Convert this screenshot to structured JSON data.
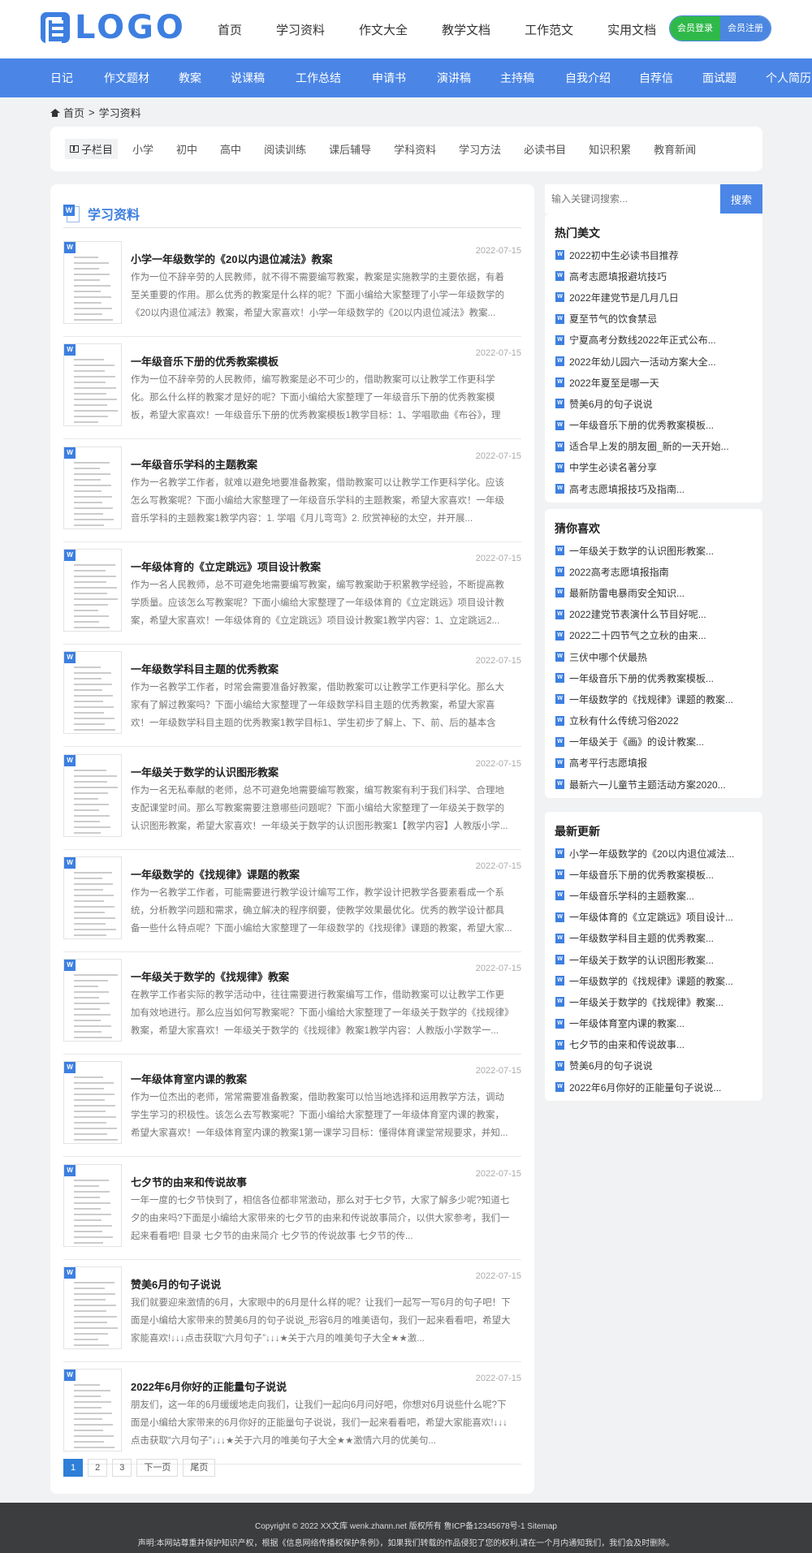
{
  "logo": {
    "text": "LOGO"
  },
  "top_nav": [
    "首页",
    "学习资料",
    "作文大全",
    "教学文档",
    "工作范文",
    "实用文档"
  ],
  "auth": {
    "login_label": "会员登录",
    "register_label": "会员注册"
  },
  "category_nav": [
    "日记",
    "作文题材",
    "教案",
    "说课稿",
    "工作总结",
    "申请书",
    "演讲稿",
    "主持稿",
    "自我介绍",
    "自荐信",
    "面试题",
    "个人简历"
  ],
  "breadcrumb": {
    "home": "首页",
    "sep": ">",
    "current": "学习资料"
  },
  "subnav": {
    "label": "子栏目",
    "items": [
      "小学",
      "初中",
      "高中",
      "阅读训练",
      "课后辅导",
      "学科资料",
      "学习方法",
      "必读书目",
      "知识积累",
      "教育新闻"
    ]
  },
  "main": {
    "title": "学习资料",
    "articles": [
      {
        "title": "小学一年级数学的《20以内退位减法》教案",
        "date": "2022-07-15",
        "desc": "作为一位不辞辛劳的人民教师，就不得不需要编写教案，教案是实施教学的主要依据，有着至关重要的作用。那么优秀的教案是什么样的呢？下面小编给大家整理了小学一年级数学的《20以内退位减法》教案，希望大家喜欢！小学一年级数学的《20以内退位减法》教案..."
      },
      {
        "title": "一年级音乐下册的优秀教案模板",
        "date": "2022-07-15",
        "desc": "作为一位不辞辛劳的人民教师，编写教案是必不可少的，借助教案可以让教学工作更科学化。那么什么样的教案才是好的呢？下面小编给大家整理了一年级音乐下册的优秀教案模板，希望大家喜欢！一年级音乐下册的优秀教案模板1教学目标：1、学唱歌曲《布谷》，理解..."
      },
      {
        "title": "一年级音乐学科的主题教案",
        "date": "2022-07-15",
        "desc": "作为一名教学工作者，就难以避免地要准备教案，借助教案可以让教学工作更科学化。应该怎么写教案呢？下面小编给大家整理了一年级音乐学科的主题教案，希望大家喜欢！一年级音乐学科的主题教案1教学内容：1. 学唱《月儿弯弯》2. 欣赏神秘的太空，并开展..."
      },
      {
        "title": "一年级体育的《立定跳远》项目设计教案",
        "date": "2022-07-15",
        "desc": "作为一名人民教师，总不可避免地需要编写教案，编写教案助于积累教学经验，不断提高教学质量。应该怎么写教案呢？下面小编给大家整理了一年级体育的《立定跳远》项目设计教案，希望大家喜欢！一年级体育的《立定跳远》项目设计教案1教学内容：1、立定跳远2..."
      },
      {
        "title": "一年级数学科目主题的优秀教案",
        "date": "2022-07-15",
        "desc": "作为一名教学工作者，时常会需要准备好教案，借助教案可以让教学工作更科学化。那么大家有了解过教案吗？下面小编给大家整理了一年级数学科目主题的优秀教案，希望大家喜欢！一年级数学科目主题的优秀教案1教学目标1、学生初步了解上、下、前、后的基本含义..."
      },
      {
        "title": "一年级关于数学的认识图形教案",
        "date": "2022-07-15",
        "desc": "作为一名无私奉献的老师，总不可避免地需要编写教案，编写教案有利于我们科学、合理地支配课堂时间。那么写教案需要注意哪些问题呢？下面小编给大家整理了一年级关于数学的认识图形教案，希望大家喜欢！一年级关于数学的认识图形教案1【教学内容】人教版小学..."
      },
      {
        "title": "一年级数学的《找规律》课题的教案",
        "date": "2022-07-15",
        "desc": "作为一名教学工作者，可能需要进行教学设计编写工作，教学设计把教学各要素看成一个系统，分析教学问题和需求，确立解决的程序纲要，使教学效果最优化。优秀的教学设计都具备一些什么特点呢？下面小编给大家整理了一年级数学的《找规律》课题的教案，希望大家..."
      },
      {
        "title": "一年级关于数学的《找规律》教案",
        "date": "2022-07-15",
        "desc": "在教学工作者实际的教学活动中，往往需要进行教案编写工作，借助教案可以让教学工作更加有效地进行。那么应当如何写教案呢？下面小编给大家整理了一年级关于数学的《找规律》教案，希望大家喜欢！一年级关于数学的《找规律》教案1教学内容：人教版小学数学一..."
      },
      {
        "title": "一年级体育室内课的教案",
        "date": "2022-07-15",
        "desc": "作为一位杰出的老师，常常需要准备教案，借助教案可以恰当地选择和运用教学方法，调动学生学习的积极性。该怎么去写教案呢？下面小编给大家整理了一年级体育室内课的教案，希望大家喜欢！一年级体育室内课的教案1第一课学习目标：懂得体育课堂常规要求，并知..."
      },
      {
        "title": "七夕节的由来和传说故事",
        "date": "2022-07-15",
        "desc": "一年一度的七夕节快到了，相信各位都非常激动，那么对于七夕节，大家了解多少呢?知道七夕的由来吗?下面是小编给大家带来的七夕节的由来和传说故事简介，以供大家参考，我们一起来看看吧! 目录 七夕节的由来简介 七夕节的传说故事 七夕节的传..."
      },
      {
        "title": "赞美6月的句子说说",
        "date": "2022-07-15",
        "desc": "我们就要迎来激情的6月，大家眼中的6月是什么样的呢？让我们一起写一写6月的句子吧！下面是小编给大家带来的赞美6月的句子说说_形容6月的唯美语句，我们一起来看看吧，希望大家能喜欢!↓↓↓点击获取“六月句子”↓↓↓★关于六月的唯美句子大全★★激..."
      },
      {
        "title": "2022年6月你好的正能量句子说说",
        "date": "2022-07-15",
        "desc": "朋友们，这一年的6月缓缓地走向我们，让我们一起向6月问好吧，你想对6月说些什么呢?下面是小编给大家带来的6月你好的正能量句子说说，我们一起来看看吧，希望大家能喜欢!↓↓↓点击获取“六月句子”↓↓↓★关于六月的唯美句子大全★★激情六月的优美句..."
      }
    ],
    "pager": [
      "1",
      "2",
      "3",
      "下一页",
      "尾页"
    ]
  },
  "search": {
    "placeholder": "输入关键词搜索...",
    "button": "搜索"
  },
  "sidebar": [
    {
      "title": "热门美文",
      "items": [
        "2022初中生必读书目推荐",
        "高考志愿填报避坑技巧",
        "2022年建党节是几月几日",
        "夏至节气的饮食禁忌",
        "宁夏高考分数线2022年正式公布...",
        "2022年幼儿园六一活动方案大全...",
        "2022年夏至是哪一天",
        "赞美6月的句子说说",
        "一年级音乐下册的优秀教案模板...",
        "适合早上发的朋友圈_新的一天开始...",
        "中学生必读名著分享",
        "高考志愿填报技巧及指南..."
      ]
    },
    {
      "title": "猜你喜欢",
      "items": [
        "一年级关于数学的认识图形教案...",
        "2022高考志愿填报指南",
        "最新防雷电暴雨安全知识...",
        "2022建党节表演什么节目好呢...",
        "2022二十四节气之立秋的由来...",
        "三伏中哪个伏最热",
        "一年级音乐下册的优秀教案模板...",
        "一年级数学的《找规律》课题的教案...",
        "立秋有什么传统习俗2022",
        "一年级关于《画》的设计教案...",
        "高考平行志愿填报",
        "最新六一儿童节主题活动方案2020..."
      ]
    },
    {
      "title": "最新更新",
      "items": [
        "小学一年级数学的《20以内退位减法...",
        "一年级音乐下册的优秀教案模板...",
        "一年级音乐学科的主题教案...",
        "一年级体育的《立定跳远》项目设计...",
        "一年级数学科目主题的优秀教案...",
        "一年级关于数学的认识图形教案...",
        "一年级数学的《找规律》课题的教案...",
        "一年级关于数学的《找规律》教案...",
        "一年级体育室内课的教案...",
        "七夕节的由来和传说故事...",
        "赞美6月的句子说说",
        "2022年6月你好的正能量句子说说..."
      ]
    }
  ],
  "footer": {
    "line1": "Copyright © 2022  XX文库  wenk.zhann.net 版权所有 鲁ICP备12345678号-1   Sitemap",
    "line2": "声明:本网站尊重并保护知识产权，根据《信息网络传播权保护条例》，如果我们转载的作品侵犯了您的权利,请在一个月内通知我们，我们会及时删除。"
  }
}
